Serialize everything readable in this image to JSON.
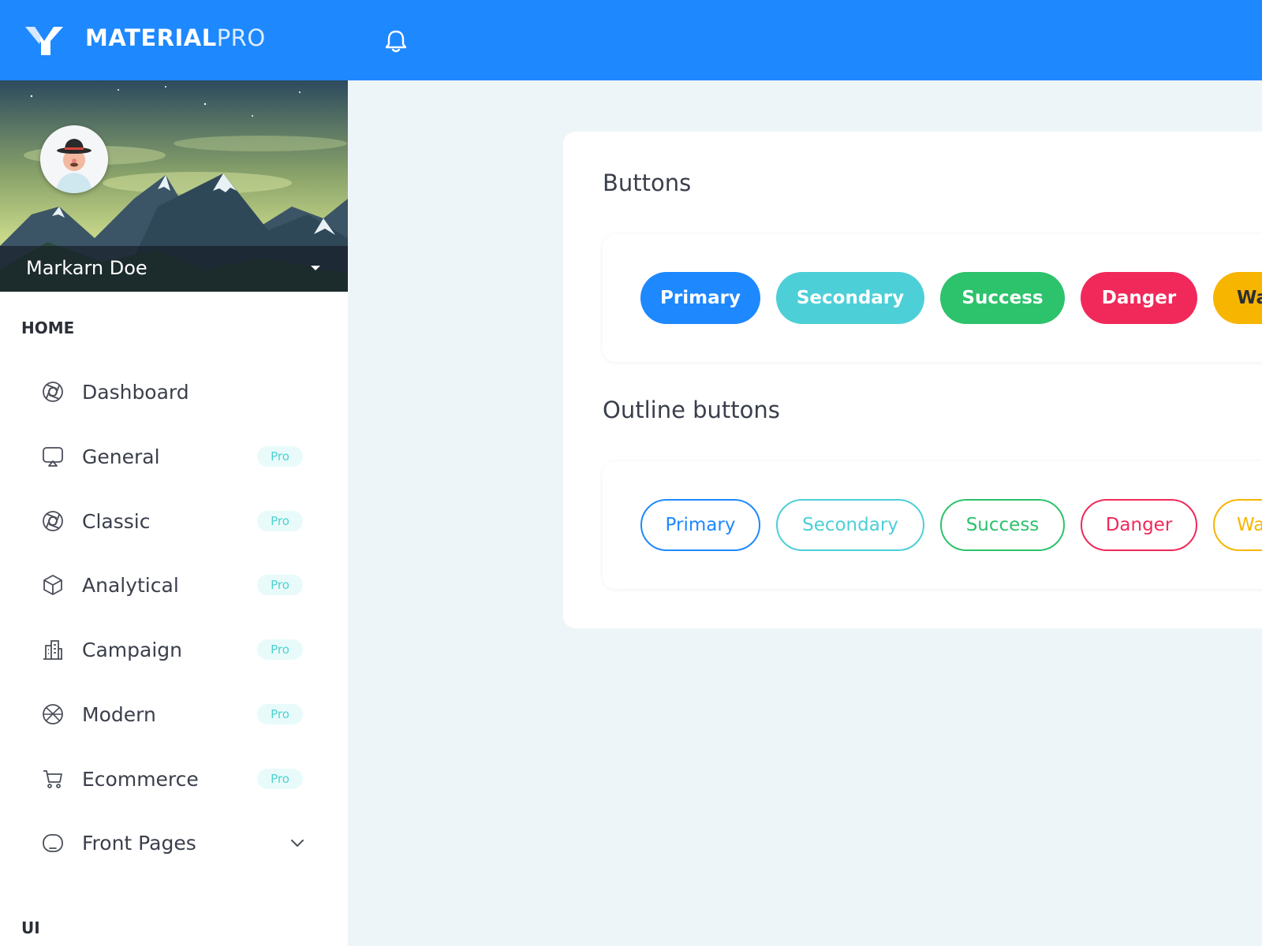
{
  "header": {
    "brand_bold": "MATERIAL",
    "brand_light": "PRO",
    "logo_icon": "materialpro-logo-icon",
    "notification_icon": "bell-icon"
  },
  "profile": {
    "name": "Markarn Doe",
    "dropdown_icon": "caret-down-icon"
  },
  "sidebar": {
    "sections": [
      {
        "heading": "HOME"
      },
      {
        "heading": "UI"
      }
    ],
    "items": [
      {
        "label": "Dashboard",
        "icon": "aperture-icon",
        "badge": ""
      },
      {
        "label": "General",
        "icon": "screen-share-icon",
        "badge": "Pro"
      },
      {
        "label": "Classic",
        "icon": "aperture-icon",
        "badge": "Pro"
      },
      {
        "label": "Analytical",
        "icon": "box-icon",
        "badge": "Pro"
      },
      {
        "label": "Campaign",
        "icon": "building-icon",
        "badge": "Pro"
      },
      {
        "label": "Modern",
        "icon": "basketball-icon",
        "badge": "Pro"
      },
      {
        "label": "Ecommerce",
        "icon": "cart-icon",
        "badge": "Pro"
      },
      {
        "label": "Front Pages",
        "icon": "app-window-icon",
        "badge": "",
        "expand_icon": "chevron-down-icon"
      }
    ]
  },
  "main": {
    "buttons_title": "Buttons",
    "outline_title": "Outline buttons",
    "buttons": [
      {
        "label": "Primary",
        "color": "#1e88fe"
      },
      {
        "label": "Secondary",
        "color": "#4dcfd7"
      },
      {
        "label": "Success",
        "color": "#2dc26c"
      },
      {
        "label": "Danger",
        "color": "#f0295a"
      },
      {
        "label": "Wa",
        "color": "#f7b500"
      }
    ],
    "outline_buttons": [
      {
        "label": "Primary",
        "color": "#1e88fe"
      },
      {
        "label": "Secondary",
        "color": "#4dcfd7"
      },
      {
        "label": "Success",
        "color": "#2dc26c"
      },
      {
        "label": "Danger",
        "color": "#f0295a"
      },
      {
        "label": "Wa",
        "color": "#f7b500"
      }
    ]
  }
}
